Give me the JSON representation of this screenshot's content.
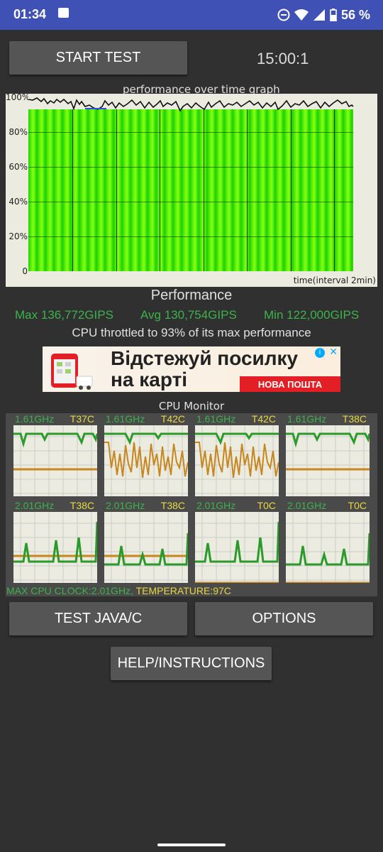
{
  "status_bar": {
    "time": "01:34",
    "battery": "56 %",
    "icons": [
      "image-icon",
      "do-not-disturb-icon",
      "wifi-icon",
      "signal-icon",
      "battery-icon"
    ]
  },
  "controls": {
    "start_label": "START TEST",
    "timer": "15:00:1"
  },
  "graph": {
    "title": "performance over time graph",
    "y_labels": [
      "100%",
      "80%",
      "60%",
      "40%",
      "20%",
      "0"
    ],
    "x_label": "time(interval 2min)"
  },
  "performance": {
    "title": "Performance",
    "max": "Max 136,772GIPS",
    "avg": "Avg 130,754GIPS",
    "min": "Min 122,000GIPS",
    "throttle": "CPU throttled to 93% of its max performance"
  },
  "ad": {
    "line1": "Відстежуй посилку",
    "line2": "на карті",
    "brand": "НОВА ПОШТА"
  },
  "cpu_monitor": {
    "title": "CPU Monitor",
    "cores": [
      {
        "freq": "1.61GHz",
        "temp": "T37C"
      },
      {
        "freq": "1.61GHz",
        "temp": "T42C"
      },
      {
        "freq": "1.61GHz",
        "temp": "T42C"
      },
      {
        "freq": "1.61GHz",
        "temp": "T38C"
      },
      {
        "freq": "2.01GHz",
        "temp": "T38C"
      },
      {
        "freq": "2.01GHz",
        "temp": "T38C"
      },
      {
        "freq": "2.01GHz",
        "temp": "T0C"
      },
      {
        "freq": "2.01GHz",
        "temp": "T0C"
      }
    ],
    "max_clock": "MAX CPU CLOCK:2.01GHz,",
    "temperature": "TEMPERATURE:97C"
  },
  "buttons": {
    "test_java": "TEST JAVA/C",
    "options": "OPTIONS",
    "help": "HELP/INSTRUCTIONS"
  },
  "colors": {
    "status_bar": "#3f51b5",
    "background": "#303030",
    "button": "#555555",
    "green_text": "#3cb34a",
    "yellow_text": "#e8d840",
    "orange_line": "#c8861e"
  }
}
